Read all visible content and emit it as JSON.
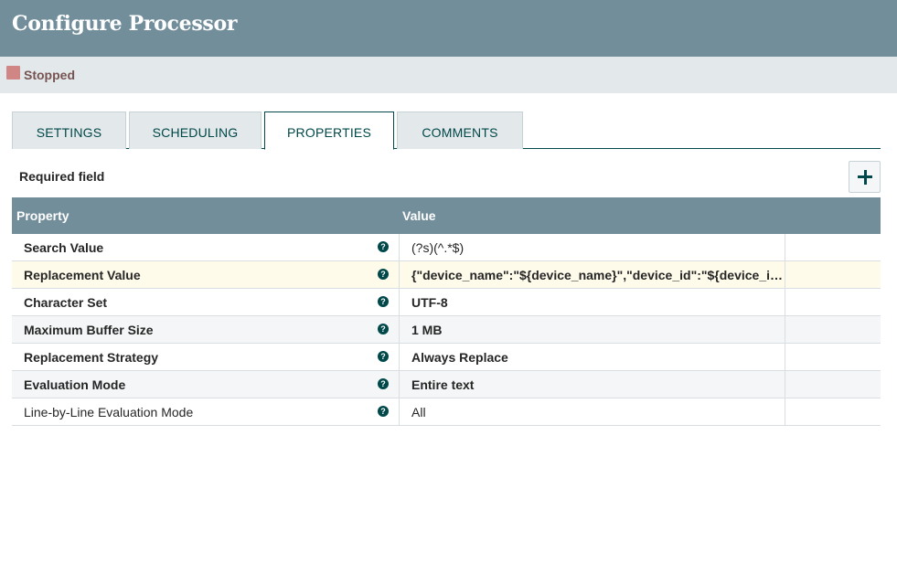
{
  "header": {
    "title": "Configure Processor"
  },
  "status": {
    "text": "Stopped",
    "color": "#d18686"
  },
  "tabs": [
    {
      "label": "SETTINGS",
      "active": false
    },
    {
      "label": "SCHEDULING",
      "active": false
    },
    {
      "label": "PROPERTIES",
      "active": true
    },
    {
      "label": "COMMENTS",
      "active": false
    }
  ],
  "properties_panel": {
    "required_label": "Required field",
    "add_button_icon": "plus-icon",
    "columns": {
      "property": "Property",
      "value": "Value"
    },
    "rows": [
      {
        "name": "Search Value",
        "value": "(?s)(^.*$)",
        "required": true,
        "value_bold": false
      },
      {
        "name": "Replacement Value",
        "value": "{\"device_name\":\"${device_name}\",\"device_id\":\"${device_id}\",\"timestamp\":\"${timestamp}\"}",
        "required": true,
        "value_bold": true,
        "selected": true
      },
      {
        "name": "Character Set",
        "value": "UTF-8",
        "required": true,
        "value_bold": true
      },
      {
        "name": "Maximum Buffer Size",
        "value": "1 MB",
        "required": true,
        "value_bold": true
      },
      {
        "name": "Replacement Strategy",
        "value": "Always Replace",
        "required": true,
        "value_bold": true
      },
      {
        "name": "Evaluation Mode",
        "value": "Entire text",
        "required": true,
        "value_bold": true
      },
      {
        "name": "Line-by-Line Evaluation Mode",
        "value": "All",
        "required": false,
        "value_bold": false
      }
    ]
  },
  "colors": {
    "header_bg": "#728e9b",
    "accent": "#004849",
    "status_bar_bg": "#e3e8eb",
    "selected_row_bg": "#fffbea"
  }
}
